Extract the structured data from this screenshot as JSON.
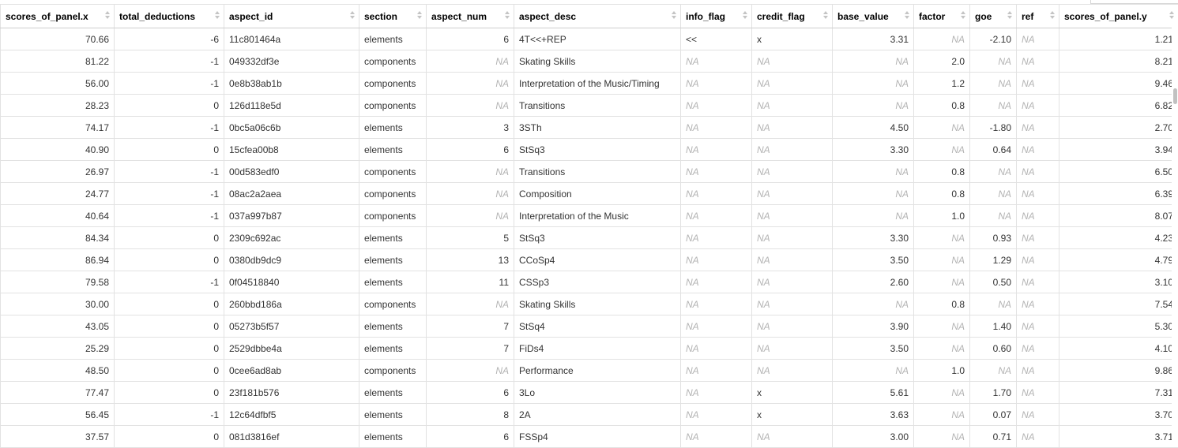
{
  "grid": {
    "columns": [
      {
        "key": "scores_of_panel_x",
        "label": "scores_of_panel.x",
        "align": "num"
      },
      {
        "key": "total_deductions",
        "label": "total_deductions",
        "align": "num"
      },
      {
        "key": "aspect_id",
        "label": "aspect_id",
        "align": "txt"
      },
      {
        "key": "section",
        "label": "section",
        "align": "txt"
      },
      {
        "key": "aspect_num",
        "label": "aspect_num",
        "align": "num"
      },
      {
        "key": "aspect_desc",
        "label": "aspect_desc",
        "align": "txt"
      },
      {
        "key": "info_flag",
        "label": "info_flag",
        "align": "txt"
      },
      {
        "key": "credit_flag",
        "label": "credit_flag",
        "align": "txt"
      },
      {
        "key": "base_value",
        "label": "base_value",
        "align": "num"
      },
      {
        "key": "factor",
        "label": "factor",
        "align": "num"
      },
      {
        "key": "goe",
        "label": "goe",
        "align": "num"
      },
      {
        "key": "ref",
        "label": "ref",
        "align": "txt"
      },
      {
        "key": "scores_of_panel_y",
        "label": "scores_of_panel.y",
        "align": "num"
      }
    ],
    "na_text": "NA",
    "rows": [
      [
        "70.66",
        "-6",
        "11c801464a",
        "elements",
        "6",
        "4T<<+REP",
        "<<",
        "x",
        "3.31",
        "NA",
        "-2.10",
        "NA",
        "1.21"
      ],
      [
        "81.22",
        "-1",
        "049332df3e",
        "components",
        "NA",
        "Skating Skills",
        "NA",
        "NA",
        "NA",
        "2.0",
        "NA",
        "NA",
        "8.21"
      ],
      [
        "56.00",
        "-1",
        "0e8b38ab1b",
        "components",
        "NA",
        "Interpretation of the Music/Timing",
        "NA",
        "NA",
        "NA",
        "1.2",
        "NA",
        "NA",
        "9.46"
      ],
      [
        "28.23",
        "0",
        "126d118e5d",
        "components",
        "NA",
        "Transitions",
        "NA",
        "NA",
        "NA",
        "0.8",
        "NA",
        "NA",
        "6.82"
      ],
      [
        "74.17",
        "-1",
        "0bc5a06c6b",
        "elements",
        "3",
        "3STh",
        "NA",
        "NA",
        "4.50",
        "NA",
        "-1.80",
        "NA",
        "2.70"
      ],
      [
        "40.90",
        "0",
        "15cfea00b8",
        "elements",
        "6",
        "StSq3",
        "NA",
        "NA",
        "3.30",
        "NA",
        "0.64",
        "NA",
        "3.94"
      ],
      [
        "26.97",
        "-1",
        "00d583edf0",
        "components",
        "NA",
        "Transitions",
        "NA",
        "NA",
        "NA",
        "0.8",
        "NA",
        "NA",
        "6.50"
      ],
      [
        "24.77",
        "-1",
        "08ac2a2aea",
        "components",
        "NA",
        "Composition",
        "NA",
        "NA",
        "NA",
        "0.8",
        "NA",
        "NA",
        "6.39"
      ],
      [
        "40.64",
        "-1",
        "037a997b87",
        "components",
        "NA",
        "Interpretation of the Music",
        "NA",
        "NA",
        "NA",
        "1.0",
        "NA",
        "NA",
        "8.07"
      ],
      [
        "84.34",
        "0",
        "2309c692ac",
        "elements",
        "5",
        "StSq3",
        "NA",
        "NA",
        "3.30",
        "NA",
        "0.93",
        "NA",
        "4.23"
      ],
      [
        "86.94",
        "0",
        "0380db9dc9",
        "elements",
        "13",
        "CCoSp4",
        "NA",
        "NA",
        "3.50",
        "NA",
        "1.29",
        "NA",
        "4.79"
      ],
      [
        "79.58",
        "-1",
        "0f04518840",
        "elements",
        "11",
        "CSSp3",
        "NA",
        "NA",
        "2.60",
        "NA",
        "0.50",
        "NA",
        "3.10"
      ],
      [
        "30.00",
        "0",
        "260bbd186a",
        "components",
        "NA",
        "Skating Skills",
        "NA",
        "NA",
        "NA",
        "0.8",
        "NA",
        "NA",
        "7.54"
      ],
      [
        "43.05",
        "0",
        "05273b5f57",
        "elements",
        "7",
        "StSq4",
        "NA",
        "NA",
        "3.90",
        "NA",
        "1.40",
        "NA",
        "5.30"
      ],
      [
        "25.29",
        "0",
        "2529dbbe4a",
        "elements",
        "7",
        "FiDs4",
        "NA",
        "NA",
        "3.50",
        "NA",
        "0.60",
        "NA",
        "4.10"
      ],
      [
        "48.50",
        "0",
        "0cee6ad8ab",
        "components",
        "NA",
        "Performance",
        "NA",
        "NA",
        "NA",
        "1.0",
        "NA",
        "NA",
        "9.86"
      ],
      [
        "77.47",
        "0",
        "23f181b576",
        "elements",
        "6",
        "3Lo",
        "NA",
        "x",
        "5.61",
        "NA",
        "1.70",
        "NA",
        "7.31"
      ],
      [
        "56.45",
        "-1",
        "12c64dfbf5",
        "elements",
        "8",
        "2A",
        "NA",
        "x",
        "3.63",
        "NA",
        "0.07",
        "NA",
        "3.70"
      ],
      [
        "37.57",
        "0",
        "081d3816ef",
        "elements",
        "6",
        "FSSp4",
        "NA",
        "NA",
        "3.00",
        "NA",
        "0.71",
        "NA",
        "3.71"
      ]
    ]
  }
}
